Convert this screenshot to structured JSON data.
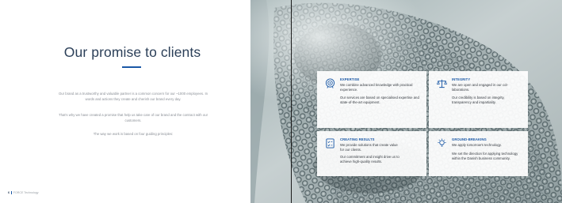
{
  "left_page": {
    "title": "Our promise to clients",
    "paragraphs": [
      "Our brand as a trustworthy and valuable partner is a common concern for our ~1000 employees. In words and actions they create and cherish our brand every day.",
      "That's why we have created a promise that help us take care of our brand and the contract with our customers.",
      "The way we work is based on four guiding principles:"
    ],
    "footer": {
      "page": "6",
      "text": "FORCE Technology"
    }
  },
  "cards": [
    {
      "icon": "target-icon",
      "heading": "EXPERTISE",
      "lines": [
        "We combine advanced knowledge with practical experience.",
        "Our services are based on specialised expertise and state-of-the-art equipment."
      ]
    },
    {
      "icon": "scales-icon",
      "heading": "INTEGRITY",
      "lines": [
        "We are open and engaged in our col-laborations.",
        "Our credibility is based on integrity, transparency and impartiality."
      ]
    },
    {
      "icon": "checklist-icon",
      "heading": "CREATING RESULTS",
      "lines": [
        "We provide solutions that create value for our clients.",
        "Our commitment and insight drive us to achieve high-quality results."
      ]
    },
    {
      "icon": "lightbulb-icon",
      "heading": "GROUND-BREAKING",
      "lines": [
        "We apply tomorrow's technology.",
        "We set the direction for applying technology within the Danish business community."
      ]
    }
  ],
  "colors": {
    "accent_blue": "#1a58a6",
    "title_navy": "#2b3f58",
    "body_grey": "#8a8f96",
    "card_bg": "#ffffff"
  }
}
